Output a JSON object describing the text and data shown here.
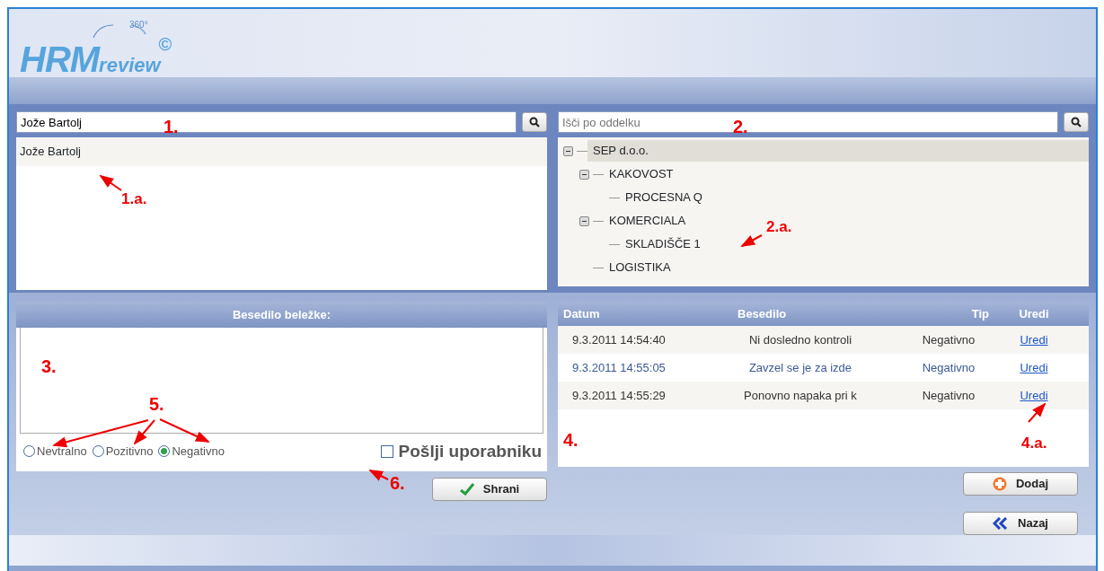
{
  "logo": {
    "main": "HRM",
    "sub": "review",
    "mark": "©",
    "badge": "360°"
  },
  "person_search": {
    "value": "Jože Bartolj"
  },
  "person_list": [
    {
      "name": "Jože Bartolj",
      "selected": true
    }
  ],
  "department_search": {
    "placeholder": "Išči po oddelku"
  },
  "department_tree": [
    {
      "label": "SEP d.o.o.",
      "selected": true,
      "expanded": true,
      "children": [
        {
          "label": "KAKOVOST",
          "selected": false,
          "expanded": true,
          "children": [
            {
              "label": "PROCESNA Q",
              "selected": false
            }
          ]
        },
        {
          "label": "KOMERCIALA",
          "selected": false,
          "expanded": true,
          "children": [
            {
              "label": "SKLADIŠČE 1",
              "selected": false
            }
          ]
        },
        {
          "label": "LOGISTIKA",
          "selected": false
        }
      ]
    }
  ],
  "note": {
    "title": "Besedilo beležke:",
    "types": [
      {
        "label": "Nevtralno",
        "selected": false
      },
      {
        "label": "Pozitivno",
        "selected": false
      },
      {
        "label": "Negativno",
        "selected": true
      }
    ],
    "send_to_user": {
      "label": "Pošlji uporabniku",
      "checked": false
    },
    "save_button": "Shrani"
  },
  "notes_table": {
    "columns": [
      "Datum",
      "Besedilo",
      "Tip",
      "Uredi"
    ],
    "rows": [
      {
        "date": "9.3.2011 14:54:40",
        "text": "Ni dosledno kontroli",
        "type": "Negativno",
        "edit": "Uredi",
        "highlighted": false
      },
      {
        "date": "9.3.2011 14:55:05",
        "text": "Zavzel se je za izde",
        "type": "Negativno",
        "edit": "Uredi",
        "highlighted": true
      },
      {
        "date": "9.3.2011 14:55:29",
        "text": "Ponovno napaka pri k",
        "type": "Negativno",
        "edit": "Uredi",
        "highlighted": false
      }
    ]
  },
  "add_button": "Dodaj",
  "back_button": "Nazaj",
  "annotations": [
    "1.",
    "1.a.",
    "2.",
    "2.a.",
    "3.",
    "4.",
    "4.a.",
    "5.",
    "6."
  ]
}
